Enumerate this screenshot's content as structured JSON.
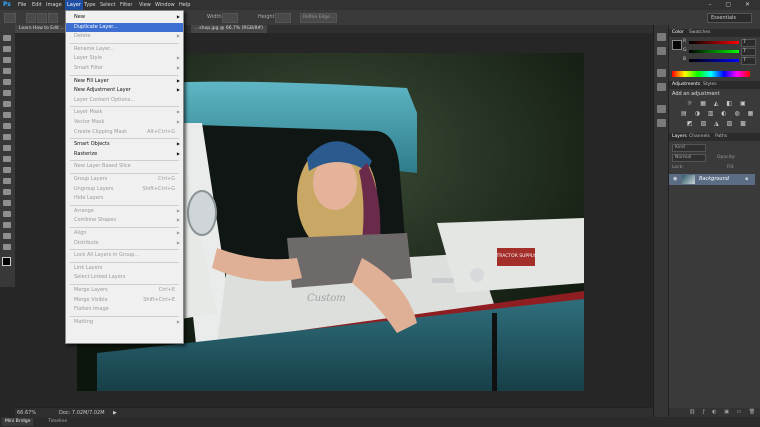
{
  "app": {
    "logo": "Ps",
    "window_controls": "– ▢ ✕"
  },
  "menubar": {
    "items": [
      "File",
      "Edit",
      "Image",
      "Layer",
      "Type",
      "Select",
      "Filter",
      "View",
      "Window",
      "Help"
    ],
    "active": "Layer"
  },
  "options": {
    "width_label": "Width:",
    "height_label": "Height:",
    "refine_edge": "Refine Edge...",
    "workspace": "Essentials"
  },
  "document": {
    "tab_left": "Learn How to Edit ...",
    "tab_right": "...shop.jpg @ 66.7% (RGB/8#)"
  },
  "status": {
    "zoom": "66.67%",
    "doc_size": "Doc: 7.02M/7.02M"
  },
  "bottom_tabs": [
    "Mini Bridge",
    "Timeline"
  ],
  "layer_menu": {
    "items": [
      {
        "label": "New",
        "submenu": true
      },
      {
        "label": "Duplicate Layer...",
        "highlighted": true
      },
      {
        "label": "Delete",
        "submenu": true,
        "disabled": true
      },
      {
        "sep": true
      },
      {
        "label": "Rename Layer...",
        "disabled": true
      },
      {
        "label": "Layer Style",
        "submenu": true,
        "disabled": true
      },
      {
        "label": "Smart Filter",
        "submenu": true,
        "disabled": true
      },
      {
        "sep": true
      },
      {
        "label": "New Fill Layer",
        "submenu": true
      },
      {
        "label": "New Adjustment Layer",
        "submenu": true
      },
      {
        "label": "Layer Content Options...",
        "disabled": true
      },
      {
        "sep": true
      },
      {
        "label": "Layer Mask",
        "submenu": true,
        "disabled": true
      },
      {
        "label": "Vector Mask",
        "submenu": true,
        "disabled": true
      },
      {
        "label": "Create Clipping Mask",
        "shortcut": "Alt+Ctrl+G",
        "disabled": true
      },
      {
        "sep": true
      },
      {
        "label": "Smart Objects",
        "submenu": true
      },
      {
        "label": "Rasterize",
        "submenu": true
      },
      {
        "sep": true
      },
      {
        "label": "New Layer Based Slice",
        "disabled": true
      },
      {
        "sep": true
      },
      {
        "label": "Group Layers",
        "shortcut": "Ctrl+G",
        "disabled": true
      },
      {
        "label": "Ungroup Layers",
        "shortcut": "Shift+Ctrl+G",
        "disabled": true
      },
      {
        "label": "Hide Layers",
        "disabled": true
      },
      {
        "sep": true
      },
      {
        "label": "Arrange",
        "submenu": true,
        "disabled": true
      },
      {
        "label": "Combine Shapes",
        "submenu": true,
        "disabled": true
      },
      {
        "sep": true
      },
      {
        "label": "Align",
        "submenu": true,
        "disabled": true
      },
      {
        "label": "Distribute",
        "submenu": true,
        "disabled": true
      },
      {
        "sep": true
      },
      {
        "label": "Lock All Layers in Group...",
        "disabled": true
      },
      {
        "sep": true
      },
      {
        "label": "Link Layers",
        "disabled": true
      },
      {
        "label": "Select Linked Layers",
        "disabled": true
      },
      {
        "sep": true
      },
      {
        "label": "Merge Layers",
        "shortcut": "Ctrl+E",
        "disabled": true
      },
      {
        "label": "Merge Visible",
        "shortcut": "Shift+Ctrl+E",
        "disabled": true
      },
      {
        "label": "Flatten Image",
        "disabled": true
      },
      {
        "sep": true
      },
      {
        "label": "Matting",
        "submenu": true,
        "disabled": true
      }
    ]
  },
  "color_panel": {
    "tabs": [
      "Color",
      "Swatches"
    ],
    "channels": [
      {
        "label": "R",
        "value": "7"
      },
      {
        "label": "G",
        "value": "7"
      },
      {
        "label": "B",
        "value": "7"
      }
    ]
  },
  "adjustments_panel": {
    "tabs": [
      "Adjustments",
      "Styles"
    ],
    "title": "Add an adjustment"
  },
  "layers_panel": {
    "tabs": [
      "Layers",
      "Channels",
      "Paths"
    ],
    "filter": "Kind",
    "blend_mode": "Normal",
    "opacity_label": "Opacity:",
    "lock_label": "Lock:",
    "fill_label": "Fill:",
    "layer_name": "Background"
  },
  "photo_text": {
    "tailgate": "TRACTOR SUPPLY",
    "emblem": "Custom"
  }
}
